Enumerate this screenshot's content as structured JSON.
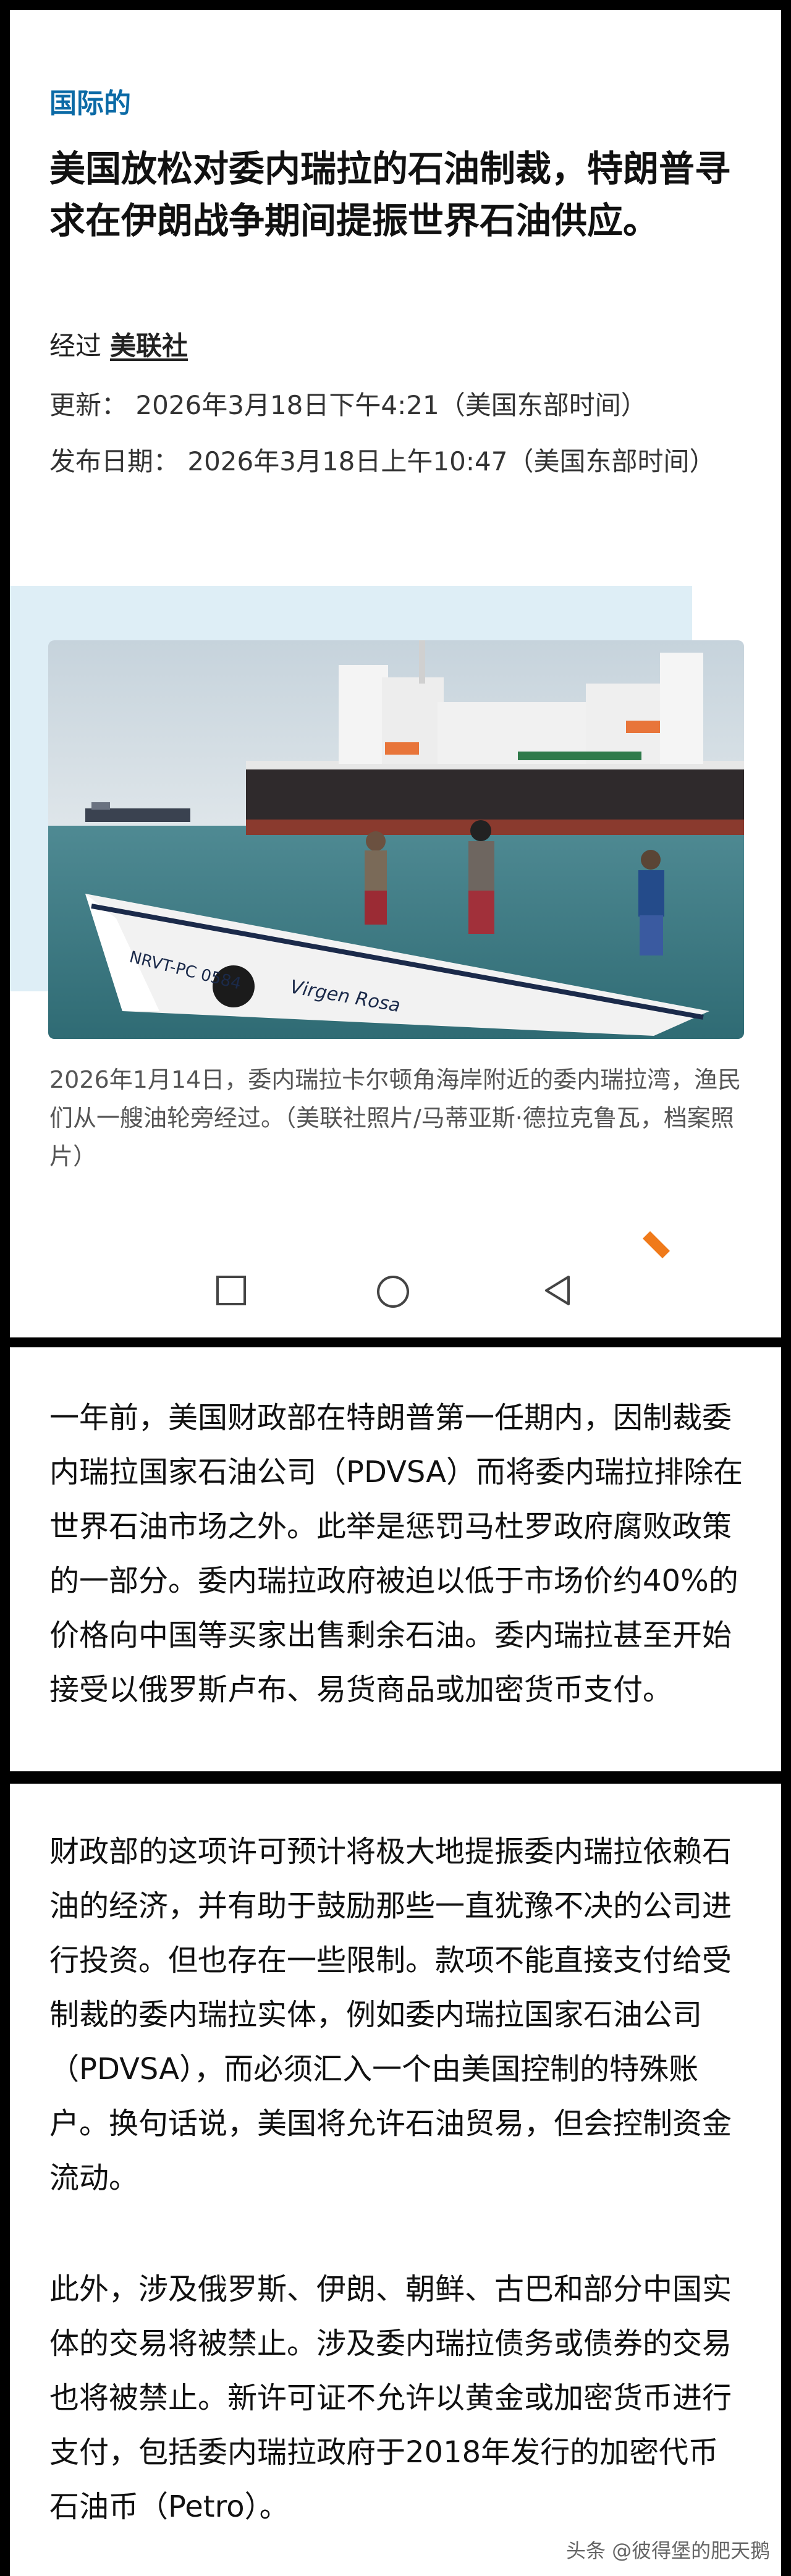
{
  "article": {
    "section": "国际的",
    "headline": "美国放松对委内瑞拉的石油制裁，特朗普寻求在伊朗战争期间提振世界石油供应。",
    "byline_prefix": "经过",
    "agency": "美联社",
    "updated": "更新： 2026年3月18日下午4:21（美国东部时间）",
    "published": "发布日期： 2026年3月18日上午10:47（美国东部时间）",
    "photo_caption": "2026年1月14日，委内瑞拉卡尔顿角海岸附近的委内瑞拉湾，渔民们从一艘油轮旁经过。（美联社照片/马蒂亚斯·德拉克鲁瓦，档案照片）",
    "boat_text": "Virgen Rosa",
    "boat_number": "NRVT-PC 0584"
  },
  "nav": {
    "back_icon": "triangle-back-icon",
    "home_icon": "circle-home-icon",
    "recent_icon": "square-recents-icon"
  },
  "paragraphs": {
    "p1": "一年前，美国财政部在特朗普第一任期内，因制裁委内瑞拉国家石油公司（PDVSA）而将委内瑞拉排除在世界石油市场之外。此举是惩罚马杜罗政府腐败政策的一部分。委内瑞拉政府被迫以低于市场价约40%的价格向中国等买家出售剩余石油。委内瑞拉甚至开始接受以俄罗斯卢布、易货商品或加密货币支付。",
    "p2": "财政部的这项许可预计将极大地提振委内瑞拉依赖石油的经济，并有助于鼓励那些一直犹豫不决的公司进行投资。但也存在一些限制。款项不能直接支付给受制裁的委内瑞拉实体，例如委内瑞拉国家石油公司（PDVSA），而必须汇入一个由美国控制的特殊账户。换句话说，美国将允许石油贸易，但会控制资金流动。",
    "p3": "此外，涉及俄罗斯、伊朗、朝鲜、古巴和部分中国实体的交易将被禁止。涉及委内瑞拉债务或债券的交易也将被禁止。新许可证不允许以黄金或加密货币进行支付，包括委内瑞拉政府于2018年发行的加密代币石油币（Petro）。"
  },
  "watermark": "头条 @彼得堡的肥天鹅",
  "colors": {
    "section": "#0b6aa6",
    "accent_orange": "#f07a1a",
    "photo_bg": "#deeef6"
  }
}
